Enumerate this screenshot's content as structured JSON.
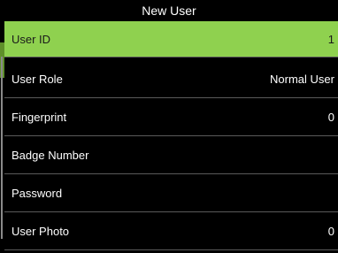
{
  "window": {
    "title": "New User"
  },
  "menu": {
    "items": [
      {
        "label": "User ID",
        "value": "1",
        "selected": true
      },
      {
        "label": "User Role",
        "value": "Normal User",
        "selected": false
      },
      {
        "label": "Fingerprint",
        "value": "0",
        "selected": false
      },
      {
        "label": "Badge Number",
        "value": "",
        "selected": false
      },
      {
        "label": "Password",
        "value": "",
        "selected": false
      },
      {
        "label": "User Photo",
        "value": "0",
        "selected": false
      }
    ]
  },
  "colors": {
    "background": "#000000",
    "selected_row": "#8fd14f",
    "text": "#ffffff",
    "selected_text": "#1a1a1a",
    "divider": "#5a5a5a"
  }
}
